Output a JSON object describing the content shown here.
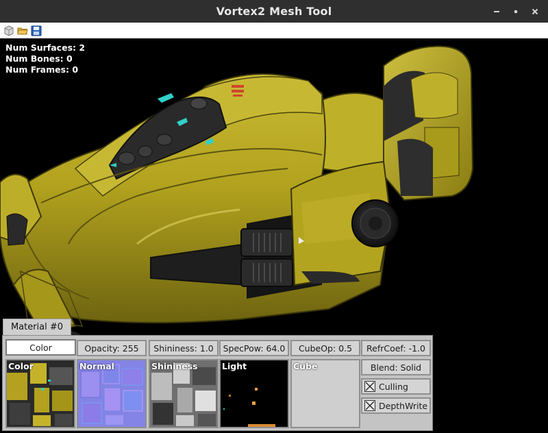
{
  "window": {
    "title": "Vortex2 Mesh Tool",
    "controls": {
      "minimize": "minimize-icon",
      "maximize": "maximize-icon",
      "close": "close-icon"
    }
  },
  "toolbar": {
    "icons": [
      "new-mesh-icon",
      "open-folder-icon",
      "save-icon"
    ]
  },
  "stats": {
    "surfaces": "Num Surfaces: 2",
    "bones": "Num Bones: 0",
    "frames": "Num Frames: 0"
  },
  "material": {
    "tab_label": "Material #0",
    "buttons": {
      "color": "Color",
      "opacity": "Opacity: 255",
      "shininess": "Shininess: 1.0",
      "specpow": "SpecPow: 64.0",
      "cubeop": "CubeOp: 0.5",
      "refrcoef": "RefrCoef: -1.0",
      "blend": "Blend: Solid"
    },
    "textures": {
      "color": "Color",
      "normal": "Normal",
      "shininess": "Shininess",
      "light": "Light",
      "cube": "Cube"
    },
    "checkboxes": {
      "culling": "Culling",
      "culling_checked": true,
      "depthwrite": "DepthWrite",
      "depthwrite_checked": true
    }
  },
  "colors": {
    "titlebar": "#2f2f2f",
    "viewport_bg": "#000000",
    "hull_yellow": "#b5a51f",
    "panel_bg": "#c4c4c4"
  }
}
